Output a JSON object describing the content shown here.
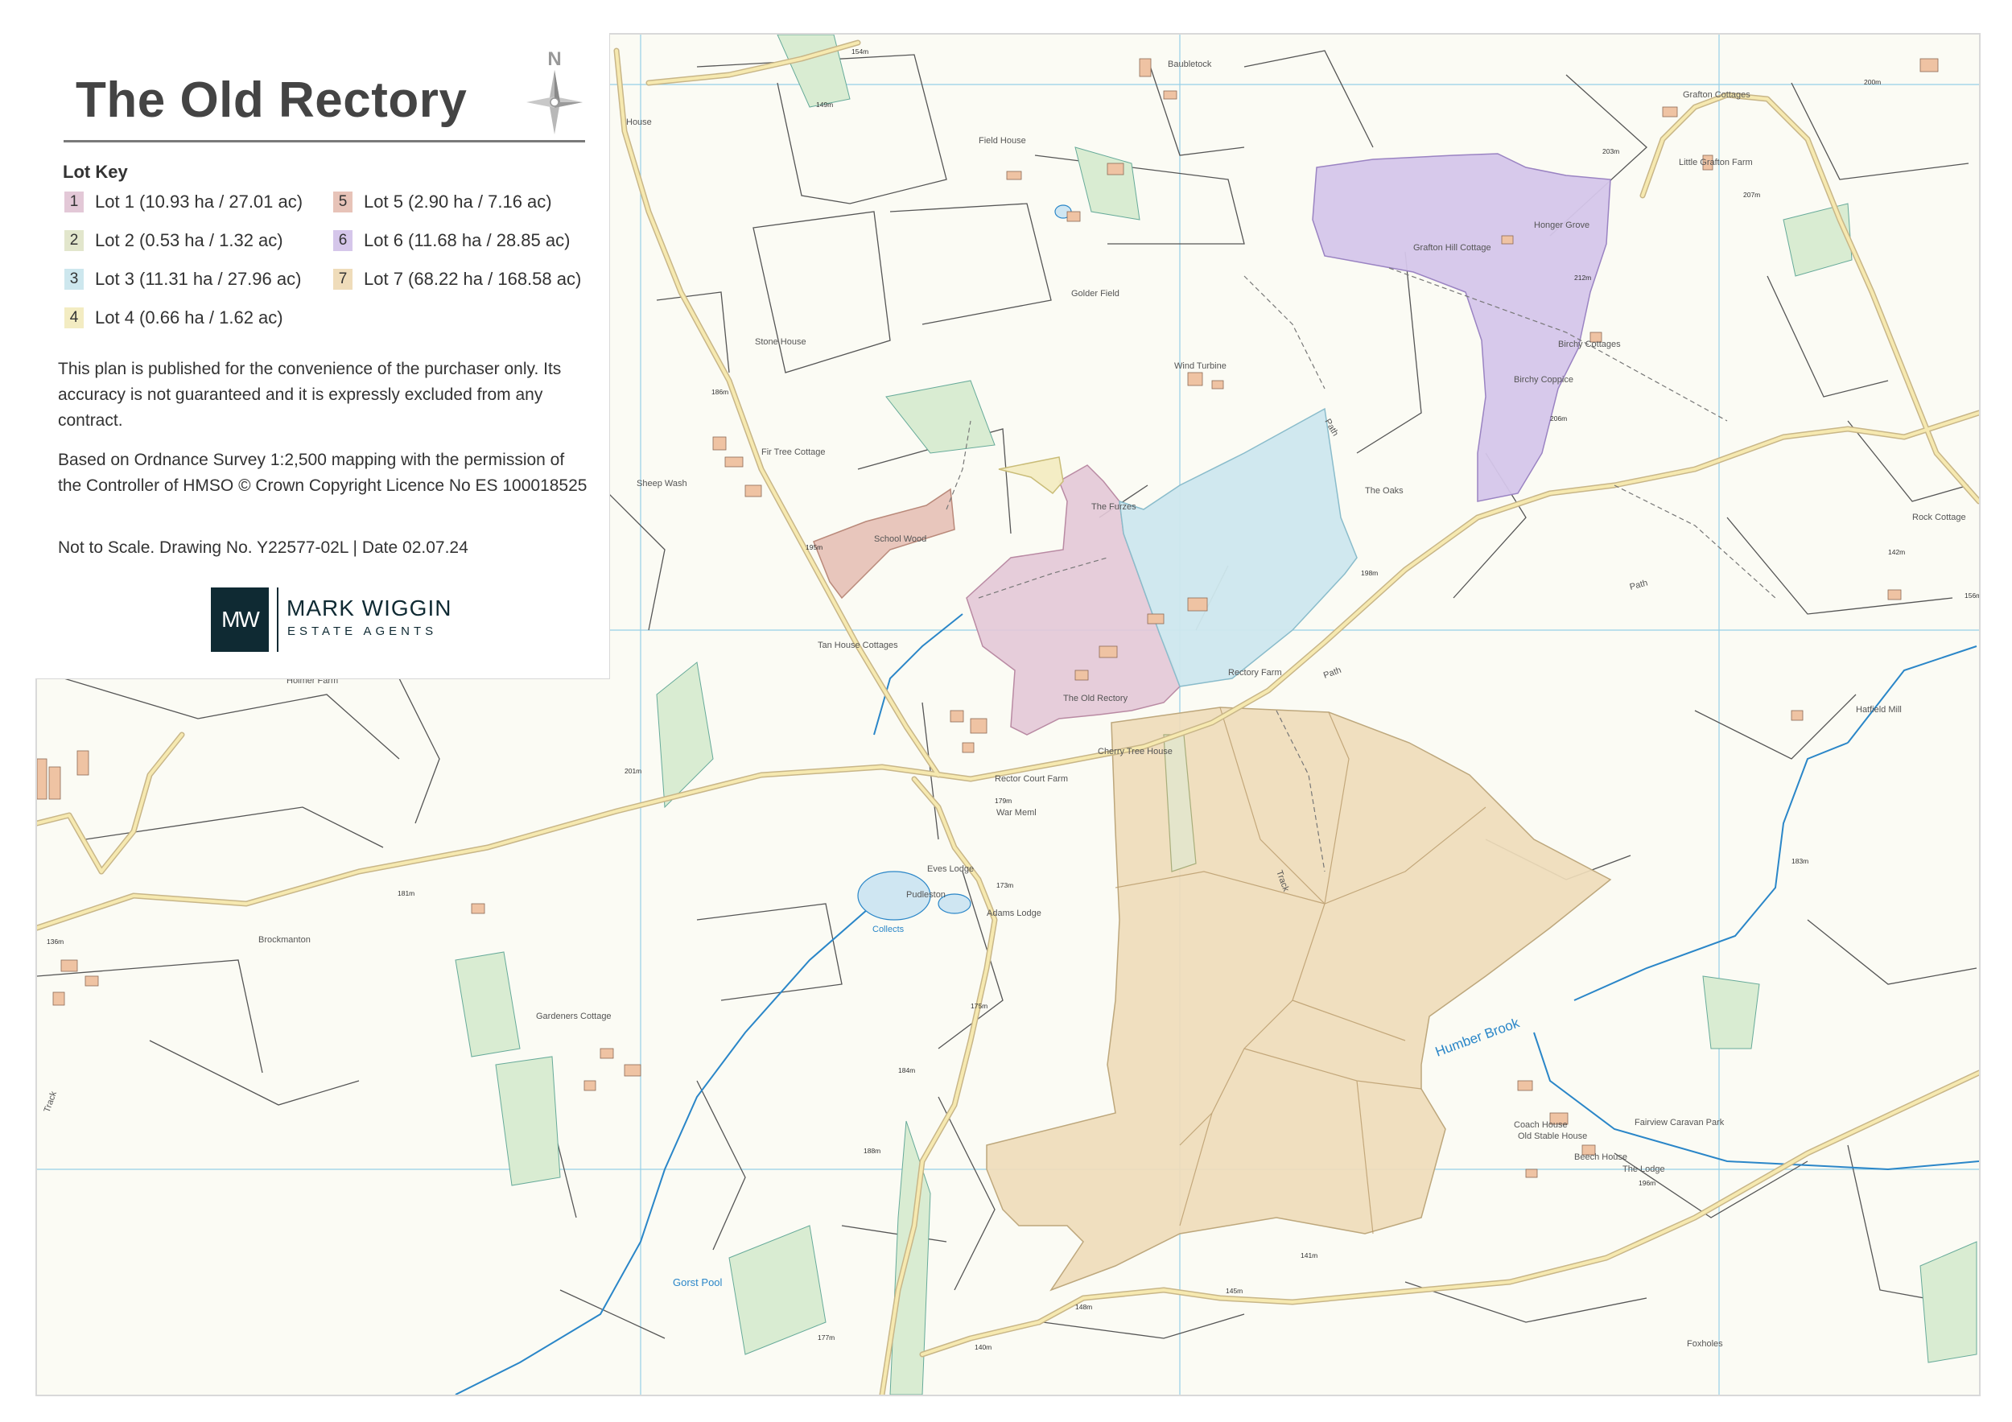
{
  "title": "The Old Rectory",
  "compass_label": "N",
  "lot_key": {
    "heading": "Lot Key",
    "lots": [
      {
        "num": "1",
        "label": "Lot 1 (10.93 ha / 27.01 ac)",
        "color": "#e3c8d7"
      },
      {
        "num": "2",
        "label": "Lot 2 (0.53 ha / 1.32 ac)",
        "color": "#e2e6cc"
      },
      {
        "num": "3",
        "label": "Lot 3 (11.31 ha / 27.96 ac)",
        "color": "#cde7ee"
      },
      {
        "num": "4",
        "label": "Lot 4 (0.66 ha / 1.62 ac)",
        "color": "#f3ecc2"
      },
      {
        "num": "5",
        "label": "Lot 5 (2.90 ha / 7.16 ac)",
        "color": "#e7c3b8"
      },
      {
        "num": "6",
        "label": "Lot 6 (11.68 ha / 28.85 ac)",
        "color": "#d5c6ea"
      },
      {
        "num": "7",
        "label": "Lot 7 (68.22 ha / 168.58 ac)",
        "color": "#efdcba"
      }
    ]
  },
  "disclaimer": "This plan is published for the convenience of the purchaser only. Its accuracy is not guaranteed and it is expressly excluded from any contract.",
  "os_notice": "Based on Ordnance Survey 1:2,500 mapping with the permission of the Controller of HMSO © Crown Copyright Licence No ES 100018525",
  "drawing_info": "Not to Scale. Drawing No. Y22577-02L | Date 02.07.24",
  "logo": {
    "mark": "MW",
    "name": "MARK WIGGIN",
    "subtitle": "ESTATE AGENTS"
  },
  "map_labels": {
    "places": {
      "golder_field": "Golder Field",
      "wind_turbine": "Wind Turbine",
      "stone_house": "Stone House",
      "fir_tree_cottage": "Fir Tree Cottage",
      "sheep_wash": "Sheep Wash",
      "school_wood": "School Wood",
      "the_furzes": "The Furzes",
      "the_oaks": "The Oaks",
      "rectory_farm": "Rectory Farm",
      "the_old_rectory": "The Old Rectory",
      "cherry_tree_house": "Cherry Tree House",
      "tan_house_cottages": "Tan House Cottages",
      "holmer_farm": "Holmer Farm",
      "rector_court_farm": "Rector Court Farm",
      "war_meml": "War Meml",
      "eves_lodge": "Eves Lodge",
      "pudleston": "Pudleston",
      "adams_lodge": "Adams Lodge",
      "brockmanton": "Brockmanton",
      "gardeners_cottage": "Gardeners Cottage",
      "grafton_hill_cottage": "Grafton Hill Cottage",
      "honger_grove": "Honger Grove",
      "birchy_cottages": "Birchy Cottages",
      "birchy_coppice": "Birchy Coppice",
      "grafton_cottages": "Grafton Cottages",
      "little_grafton_farm": "Little Grafton Farm",
      "rock_cottage": "Rock Cottage",
      "hatfield_mill": "Hatfield Mill",
      "coach_house": "Coach House",
      "old_stable_house": "Old Stable House",
      "fairview_caravan_park": "Fairview Caravan Park",
      "beech_house": "Beech House",
      "the_lodge": "The Lodge",
      "foxholes": "Foxholes",
      "baubletock": "Baubletock",
      "field_house": "Field House",
      "house": "House"
    },
    "water": {
      "humber_brook": "Humber Brook",
      "collects": "Collects",
      "gorst_pool": "Gorst Pool"
    },
    "paths": {
      "path": "Path",
      "track": "Track"
    },
    "heights": {
      "h154": "154m",
      "h149": "149m",
      "h186": "186m",
      "h195": "195m",
      "h201": "201m",
      "h181": "181m",
      "h136": "136m",
      "h179": "179m",
      "h173": "173m",
      "h175": "175m",
      "h184": "184m",
      "h188": "188m",
      "h177": "177m",
      "h148": "148m",
      "h140": "140m",
      "h141": "141m",
      "h145": "145m",
      "h196": "196m",
      "h183": "183m",
      "h203": "203m",
      "h207": "207m",
      "h212": "212m",
      "h206": "206m",
      "h198": "198m",
      "h200": "200m",
      "h142": "142m",
      "h156": "156m"
    }
  }
}
